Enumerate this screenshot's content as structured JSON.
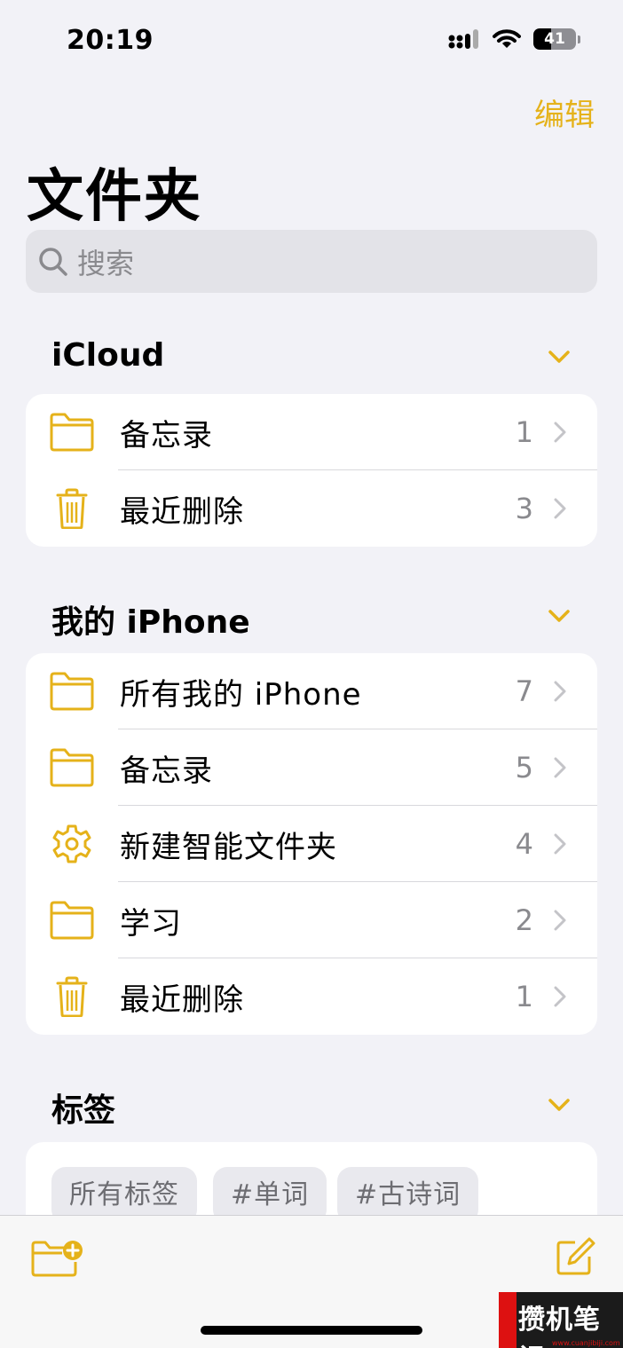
{
  "status": {
    "time": "20:19",
    "battery": "41"
  },
  "nav": {
    "edit_label": "编辑",
    "title": "文件夹"
  },
  "search": {
    "placeholder": "搜索"
  },
  "sections": {
    "icloud": {
      "title": "iCloud",
      "items": [
        {
          "label": "备忘录",
          "count": "1",
          "icon": "folder-icon"
        },
        {
          "label": "最近删除",
          "count": "3",
          "icon": "trash-icon"
        }
      ]
    },
    "iphone": {
      "title": "我的 iPhone",
      "items": [
        {
          "label": "所有我的 iPhone",
          "count": "7",
          "icon": "folder-icon"
        },
        {
          "label": "备忘录",
          "count": "5",
          "icon": "folder-icon"
        },
        {
          "label": "新建智能文件夹",
          "count": "4",
          "icon": "gear-icon"
        },
        {
          "label": "学习",
          "count": "2",
          "icon": "folder-icon"
        },
        {
          "label": "最近删除",
          "count": "1",
          "icon": "trash-icon"
        }
      ]
    },
    "tags": {
      "title": "标签",
      "items": [
        "所有标签",
        "#单词",
        "#古诗词"
      ]
    }
  },
  "toolbar": {
    "new_folder_icon": "new-folder-icon",
    "compose_icon": "compose-icon"
  },
  "watermark": {
    "text": "攒机笔记",
    "url": "www.cuanjibiji.com"
  },
  "colors": {
    "accent": "#e5b21a",
    "background": "#f2f2f7",
    "secondary_text": "#8a8a8e"
  }
}
